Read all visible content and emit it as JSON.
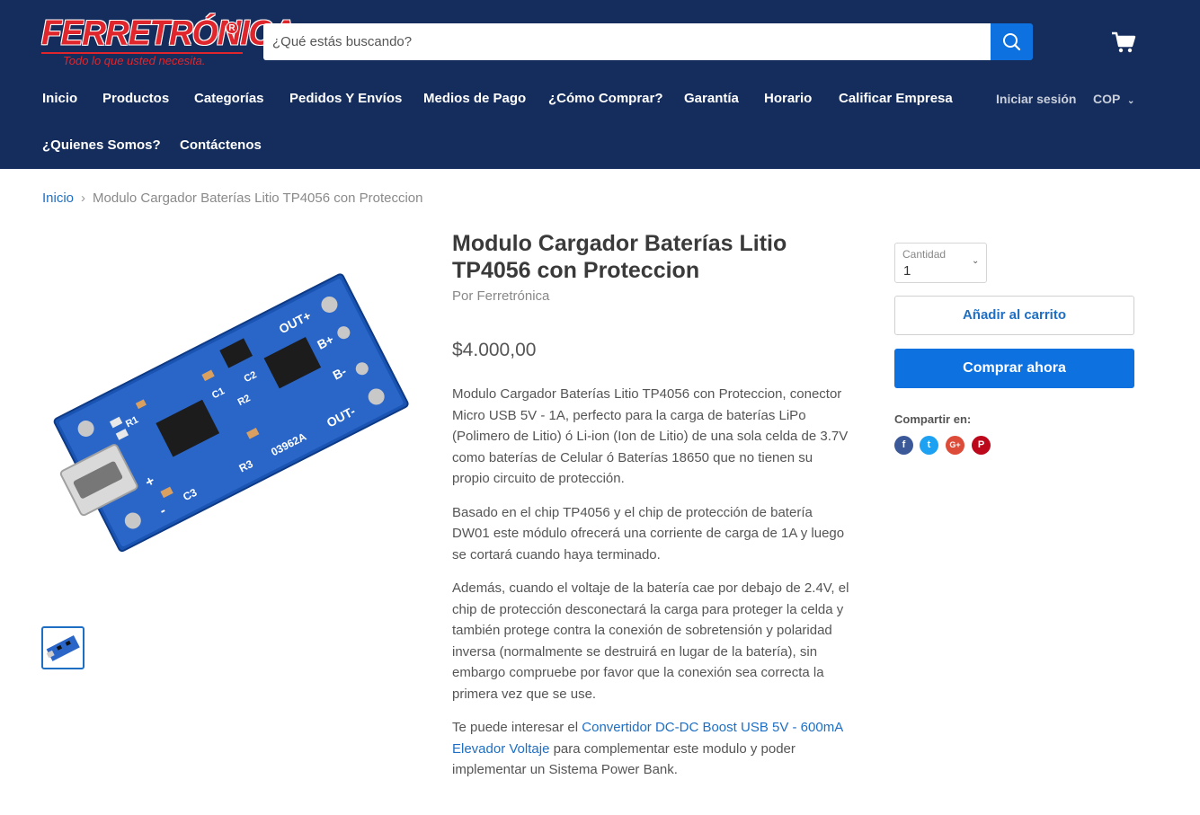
{
  "header": {
    "logo_text": "FERRETRÓNICA",
    "logo_tagline": "Todo lo que usted necesita.",
    "search_placeholder": "¿Qué estás buscando?",
    "nav_row1": [
      "Inicio",
      "Productos",
      "Categorías",
      "Pedidos Y Envíos",
      "Medios de Pago",
      "¿Cómo Comprar?",
      "Garantía",
      "Horario",
      "Calificar Empresa"
    ],
    "nav_row2": [
      "¿Quienes Somos?",
      "Contáctenos"
    ],
    "login": "Iniciar sesión",
    "currency": "COP"
  },
  "breadcrumb": {
    "home": "Inicio",
    "separator": "›",
    "current": "Modulo Cargador Baterías Litio TP4056 con Proteccion"
  },
  "product": {
    "title": "Modulo Cargador Baterías Litio TP4056 con Proteccion",
    "vendor": "Por Ferretrónica",
    "price": "$4.000,00",
    "image_labels": [
      "OUT+",
      "B+",
      "B-",
      "OUT-",
      "03962A",
      "R3",
      "C3",
      "R1",
      "R2",
      "C1",
      "C2",
      "+",
      "-"
    ],
    "description": {
      "p1": "Modulo Cargador Baterías Litio TP4056 con Proteccion, conector Micro USB 5V - 1A, perfecto para la carga de baterías LiPo (Polimero de Litio) ó Li-ion (Ion de Litio) de una sola celda de 3.7V como baterías de Celular ó Baterías 18650 que no tienen su propio circuito de protección.",
      "p2": "Basado en el chip TP4056 y el chip de protección de batería DW01 este módulo ofrecerá una corriente de carga de 1A y luego se cortará cuando haya terminado.",
      "p3": "Además, cuando el voltaje de la batería cae por debajo de 2.4V, el chip de protección desconectará la carga para proteger la celda y también protege contra la conexión de sobretensión y polaridad inversa (normalmente se destruirá en lugar de la batería), sin embargo compruebe por favor que la conexión sea correcta la primera vez que se use.",
      "p4_before": "Te puede interesar el ",
      "p4_link": "Convertidor DC-DC Boost USB 5V - 600mA Elevador Voltaje",
      "p4_after": " para complementar este modulo y poder implementar un Sistema Power Bank."
    }
  },
  "purchase": {
    "qty_label": "Cantidad",
    "qty_value": "1",
    "add_to_cart": "Añadir al carrito",
    "buy_now": "Comprar ahora",
    "share_label": "Compartir en:",
    "share_icons": [
      "facebook-icon",
      "twitter-icon",
      "google-plus-icon",
      "pinterest-icon"
    ],
    "share_glyphs": [
      "f",
      "t",
      "G+",
      "P"
    ]
  },
  "colors": {
    "header_bg": "#152d5c",
    "accent_blue": "#0d72e0",
    "link_blue": "#1e6fc4",
    "brand_red": "#e0262d"
  }
}
